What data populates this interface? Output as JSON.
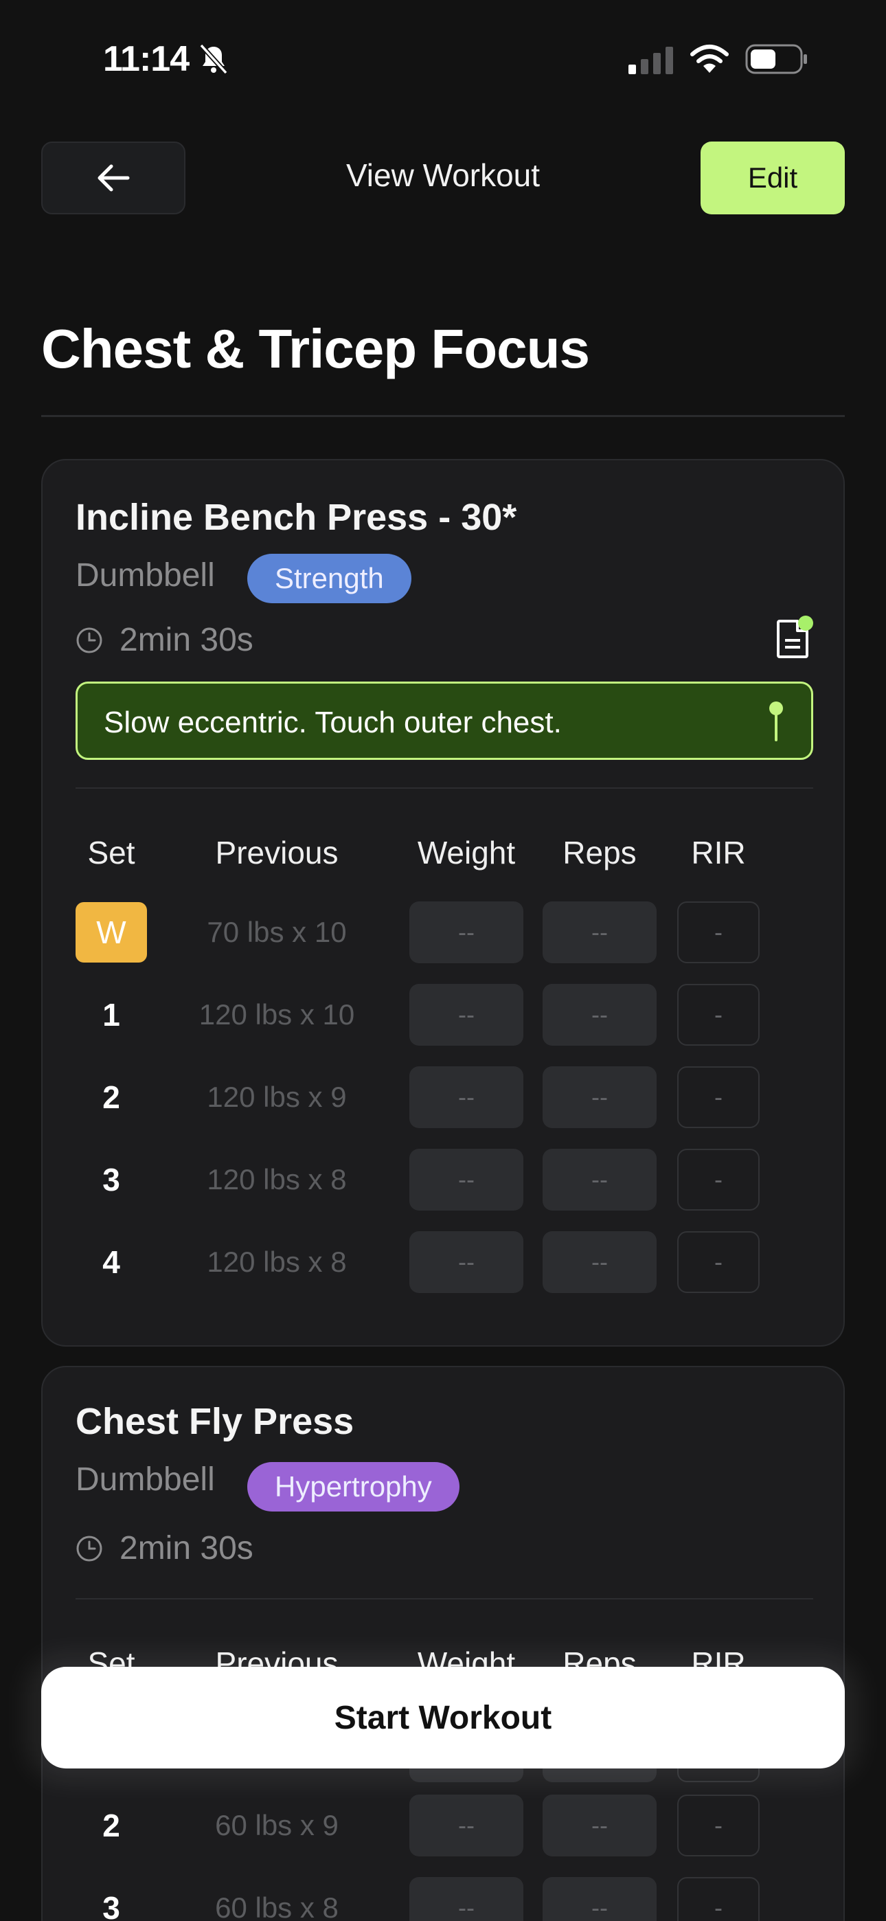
{
  "status_bar": {
    "time": "11:14"
  },
  "header": {
    "title": "View Workout",
    "edit_label": "Edit"
  },
  "workout": {
    "title": "Chest & Tricep Focus"
  },
  "columns": {
    "set": "Set",
    "previous": "Previous",
    "weight": "Weight",
    "reps": "Reps",
    "rir": "RIR"
  },
  "exercises": [
    {
      "name": "Incline Bench Press - 30*",
      "equipment": "Dumbbell",
      "tag": "Strength",
      "tag_color": "#5b84d6",
      "rest": "2min 30s",
      "note": "Slow eccentric. Touch outer chest.",
      "sets": [
        {
          "set": "W",
          "previous": "70 lbs x 10",
          "weight": "--",
          "reps": "--",
          "rir": "-"
        },
        {
          "set": "1",
          "previous": "120 lbs x 10",
          "weight": "--",
          "reps": "--",
          "rir": "-"
        },
        {
          "set": "2",
          "previous": "120 lbs x 9",
          "weight": "--",
          "reps": "--",
          "rir": "-"
        },
        {
          "set": "3",
          "previous": "120 lbs x 8",
          "weight": "--",
          "reps": "--",
          "rir": "-"
        },
        {
          "set": "4",
          "previous": "120 lbs x 8",
          "weight": "--",
          "reps": "--",
          "rir": "-"
        }
      ]
    },
    {
      "name": "Chest Fly Press",
      "equipment": "Dumbbell",
      "tag": "Hypertrophy",
      "tag_color": "#9a64d6",
      "rest": "2min 30s",
      "sets": [
        {
          "set": "2",
          "previous": "60 lbs x 9",
          "weight": "--",
          "reps": "--",
          "rir": "-"
        },
        {
          "set": "3",
          "previous": "60 lbs x 8",
          "weight": "--",
          "reps": "--",
          "rir": "-"
        }
      ]
    }
  ],
  "start_label": "Start Workout",
  "colors": {
    "accent": "#c3f57f",
    "warmup": "#f1b742",
    "background": "#121212",
    "card": "#1c1c1e"
  }
}
